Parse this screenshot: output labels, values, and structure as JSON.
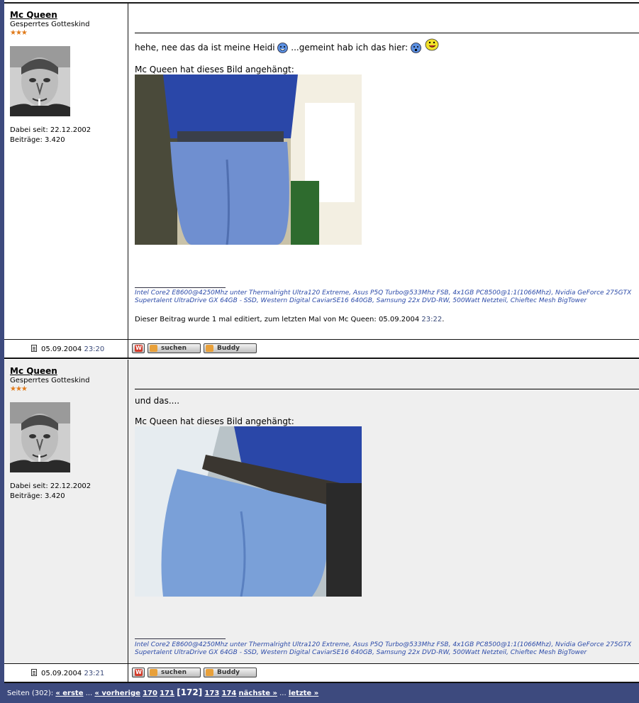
{
  "posts": [
    {
      "username": "Mc Queen",
      "user_title": "Gesperrtes Gotteskind",
      "stars": "★★★",
      "joined": "Dabei seit: 22.12.2002",
      "posts_count": "Beiträge: 3.420",
      "body_part1": "hehe, nee das da ist meine Heidi",
      "body_part2": "...gemeint hab ich das hier:",
      "attachment_label": "Mc Queen hat dieses Bild angehängt:",
      "signature_line1": "Intel Core2 E8600@4250Mhz unter Thermalright Ultra120 Extreme, Asus P5Q Turbo@533Mhz FSB, 4x1GB PC8500@1:1(1066Mhz), Nvidia GeForce 275GTX",
      "signature_line2": "Supertalent UltraDrive GX 64GB - SSD, Western Digital CaviarSE16 640GB, Samsung 22x DVD-RW, 500Watt Netzteil, Chieftec Mesh BigTower",
      "edited_text": "Dieser Beitrag wurde 1 mal editiert, zum letzten Mal von Mc Queen: 05.09.2004",
      "edited_time": "23:22",
      "post_date": "05.09.2004",
      "post_time": "23:20"
    },
    {
      "username": "Mc Queen",
      "user_title": "Gesperrtes Gotteskind",
      "stars": "★★★",
      "joined": "Dabei seit: 22.12.2002",
      "posts_count": "Beiträge: 3.420",
      "body_part1": "und das....",
      "attachment_label": "Mc Queen hat dieses Bild angehängt:",
      "signature_line1": "Intel Core2 E8600@4250Mhz unter Thermalright Ultra120 Extreme, Asus P5Q Turbo@533Mhz FSB, 4x1GB PC8500@1:1(1066Mhz), Nvidia GeForce 275GTX",
      "signature_line2": "Supertalent UltraDrive GX 64GB - SSD, Western Digital CaviarSE16 640GB, Samsung 22x DVD-RW, 500Watt Netzteil, Chieftec Mesh BigTower",
      "post_date": "05.09.2004",
      "post_time": "23:21"
    }
  ],
  "buttons": {
    "www": "W",
    "search": "suchen",
    "buddy": "Buddy"
  },
  "pagination": {
    "prefix": "Seiten (302):",
    "first": "« erste",
    "ellipsis": "...",
    "prev": "« vorherige",
    "p170": "170",
    "p171": "171",
    "current": "[172]",
    "p173": "173",
    "p174": "174",
    "next": "nächste »",
    "last": "letzte »"
  },
  "colors": {
    "nav_bar": "#3d4a7e",
    "signature": "#2b4aa8",
    "alt_row": "#efefef"
  }
}
